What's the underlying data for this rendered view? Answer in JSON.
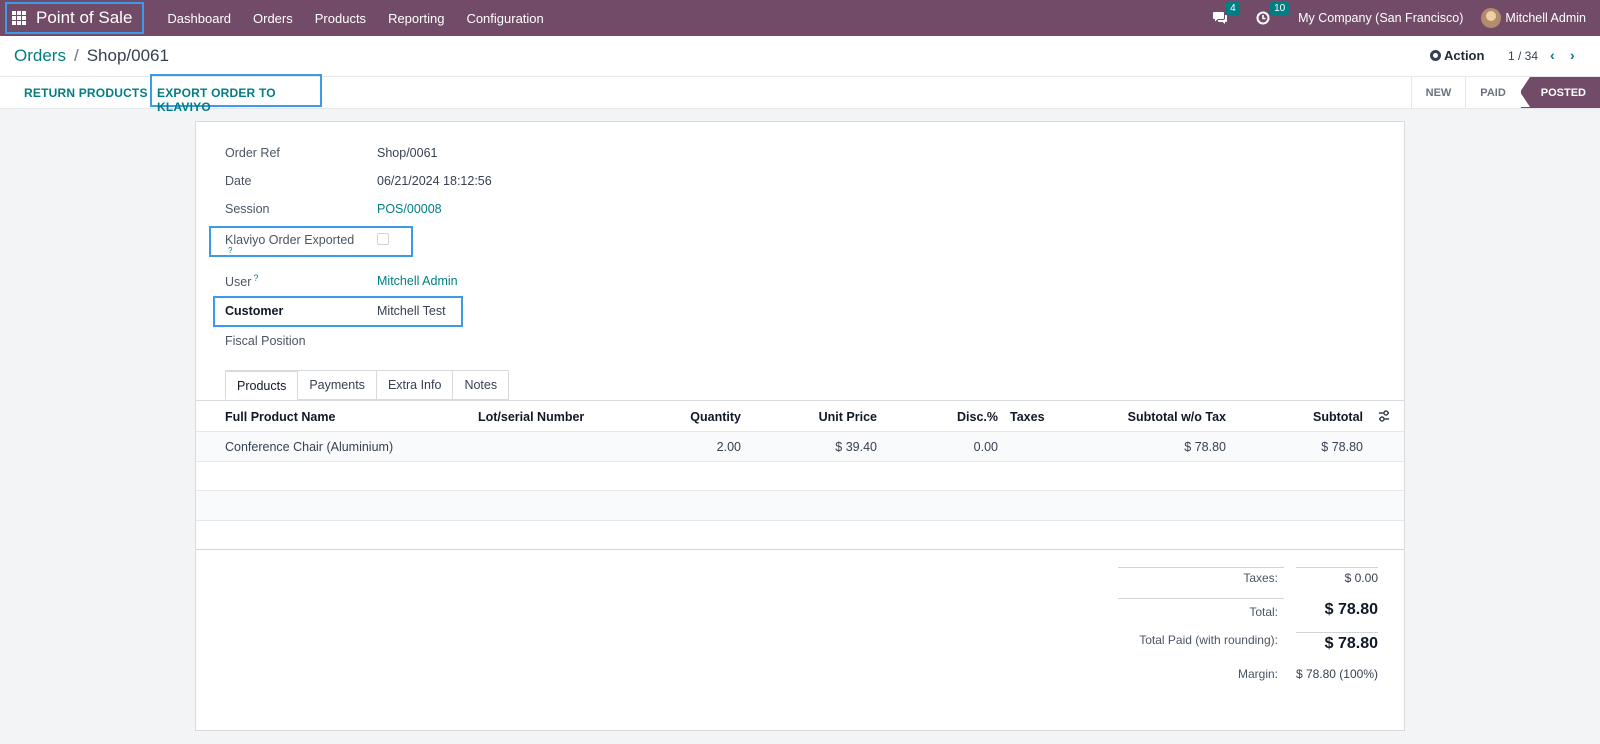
{
  "topbar": {
    "app_name": "Point of Sale",
    "menu": [
      "Dashboard",
      "Orders",
      "Products",
      "Reporting",
      "Configuration"
    ],
    "messages_count": "4",
    "activities_count": "10",
    "company": "My Company (San Francisco)",
    "user": "Mitchell Admin"
  },
  "breadcrumb": {
    "parent": "Orders",
    "separator": "/",
    "current": "Shop/0061"
  },
  "control": {
    "action_label": "Action",
    "pager": "1 / 34",
    "prev": "‹",
    "next": "›"
  },
  "statusbar": {
    "return_label": "RETURN PRODUCTS",
    "export_label": "EXPORT ORDER TO KLAVIYO",
    "stages": [
      "NEW",
      "PAID",
      "POSTED"
    ],
    "active_stage": "POSTED"
  },
  "form": {
    "order_ref_label": "Order Ref",
    "order_ref": "Shop/0061",
    "date_label": "Date",
    "date": "06/21/2024 18:12:56",
    "session_label": "Session",
    "session": "POS/00008",
    "klaviyo_label": "Klaviyo Order Exported",
    "klaviyo_help": "?",
    "klaviyo_checked": false,
    "user_label": "User",
    "user_help": "?",
    "user": "Mitchell Admin",
    "customer_label": "Customer",
    "customer": "Mitchell Test",
    "fiscal_label": "Fiscal Position",
    "fiscal": ""
  },
  "tabs": [
    "Products",
    "Payments",
    "Extra Info",
    "Notes"
  ],
  "table": {
    "headers": {
      "product": "Full Product Name",
      "lot": "Lot/serial Number",
      "qty": "Quantity",
      "price": "Unit Price",
      "disc": "Disc.%",
      "taxes": "Taxes",
      "subtotal_wo": "Subtotal w/o Tax",
      "subtotal": "Subtotal"
    },
    "rows": [
      {
        "product": "Conference Chair (Aluminium)",
        "lot": "",
        "qty": "2.00",
        "price": "$ 39.40",
        "disc": "0.00",
        "taxes": "",
        "subtotal_wo": "$ 78.80",
        "subtotal": "$ 78.80"
      }
    ]
  },
  "totals": {
    "taxes_label": "Taxes:",
    "taxes": "$ 0.00",
    "total_label": "Total:",
    "total": "$ 78.80",
    "paid_label": "Total Paid (with rounding):",
    "paid": "$ 78.80",
    "margin_label": "Margin:",
    "margin": "$ 78.80 (100%)"
  }
}
